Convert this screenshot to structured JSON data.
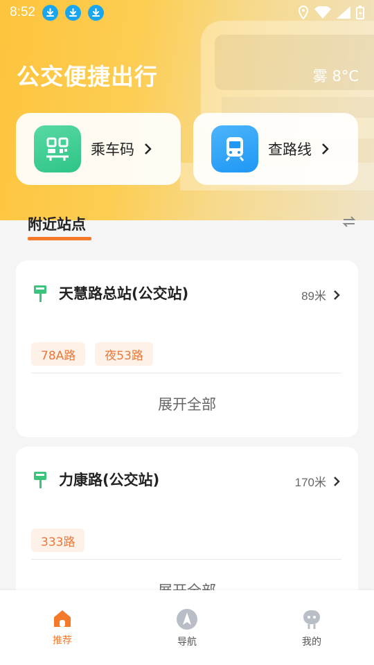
{
  "status_bar": {
    "time": "8:52"
  },
  "header": {
    "title": "公交便捷出行",
    "weather": "雾  8°C"
  },
  "quick_actions": [
    {
      "label": "乘车码",
      "icon": "qr-code-icon"
    },
    {
      "label": "查路线",
      "icon": "train-icon"
    }
  ],
  "nearby": {
    "tab_label": "附近站点"
  },
  "stations": [
    {
      "name": "天慧路总站(公交站)",
      "distance": "89米",
      "routes": [
        "78A路",
        "夜53路"
      ],
      "expand_label": "展开全部"
    },
    {
      "name": "力康路(公交站)",
      "distance": "170米",
      "routes": [
        "333路"
      ],
      "expand_label": "展开全部"
    }
  ],
  "bottom_nav": [
    {
      "label": "推荐",
      "active": true
    },
    {
      "label": "导航",
      "active": false
    },
    {
      "label": "我的",
      "active": false
    }
  ],
  "colors": {
    "accent": "#f47a2a",
    "header_yellow": "#fdc43d",
    "green": "#2ec486",
    "blue": "#1f97f5"
  }
}
